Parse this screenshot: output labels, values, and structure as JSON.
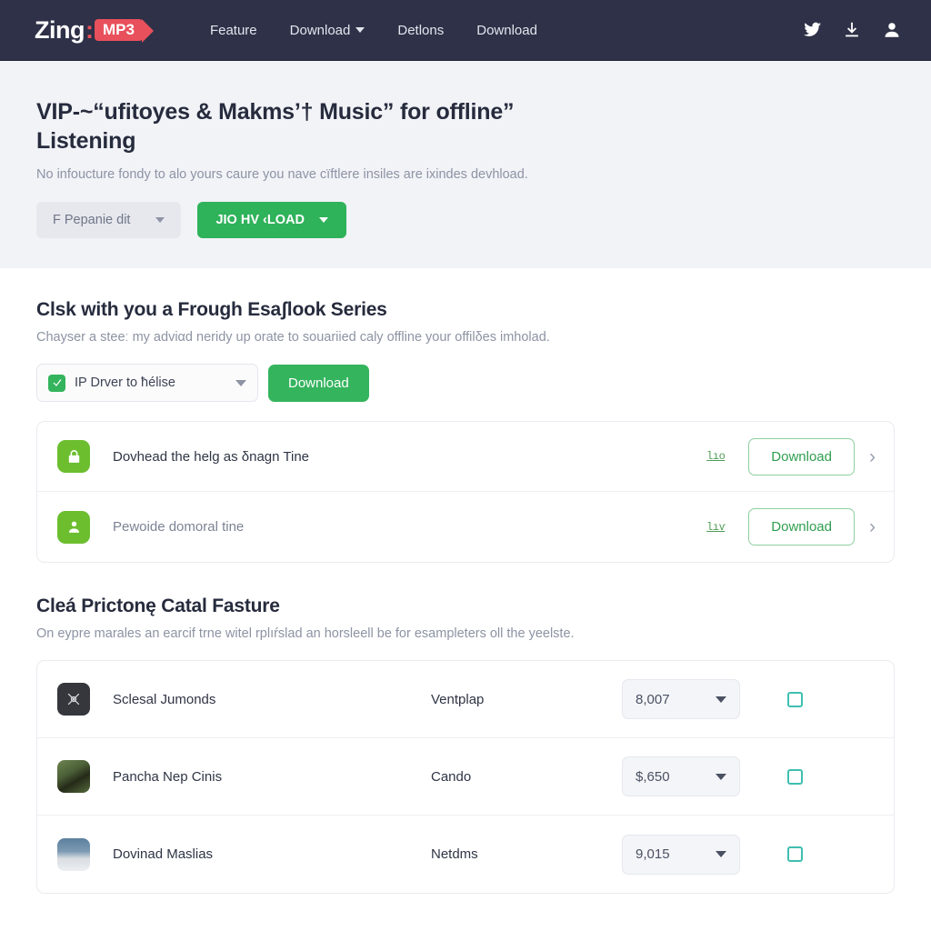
{
  "navbar": {
    "brand": {
      "name": "Zing",
      "separator": ":",
      "badge": "MP3"
    },
    "links": [
      {
        "label": "Feature",
        "has_caret": false
      },
      {
        "label": "Download",
        "has_caret": true
      },
      {
        "label": "Detlons",
        "has_caret": false
      },
      {
        "label": "Download",
        "has_caret": false
      }
    ],
    "icons": [
      {
        "name": "twitter-icon"
      },
      {
        "name": "download-icon"
      },
      {
        "name": "user-account-icon"
      }
    ],
    "background": "#2e3147"
  },
  "hero": {
    "title": "VIP-~“ufitoyes & Makms’† Music” for offline” Listening",
    "subtitle": "No infoucture fondy to alo yours caure you nave cïftlere insiles are iхindes devhload.",
    "ghost_button": {
      "label": "F Pepanie dit",
      "has_caret": true
    },
    "primary_button": {
      "label": "JIO HV ‹LOAD",
      "has_caret": true,
      "color": "#2eb25a"
    },
    "background": "#f1f3f7"
  },
  "series_section": {
    "title": "Clsk with you a Frough Esaʃlook Series",
    "subtitle": "Chayser a steeː my adviαd neridy up orate to souariied caly offline your offilδes imholad.",
    "filter": {
      "select_label": "IP Drver to ħélise",
      "checkbox_icon": "checkmark-icon",
      "download_button": "Download"
    },
    "rows": [
      {
        "icon": "lock-icon",
        "label": "Dovhead the helg as δnagn Tine",
        "mini_glyph": "lıo",
        "action": "Download",
        "muted": false
      },
      {
        "icon": "user-icon",
        "label": "Pewoide domoral tine",
        "mini_glyph": "lıѵ",
        "action": "Download",
        "muted": true
      }
    ]
  },
  "catalog_section": {
    "title": "Cleá Prictonę Catal Fasture",
    "subtitle": "On eypre marales an earcif trne witel rplıŕslad an horsleell be for esampleters oll the yeelste.",
    "rows": [
      {
        "thumbnail": "crossed-tools-thumbnail",
        "name": "Sclesal Jumonds",
        "category": "Ventplap",
        "value": "8,007",
        "checked": false
      },
      {
        "thumbnail": "nature-photo-thumbnail",
        "name": "Pancha Nep Cinis",
        "category": "Cando",
        "value": "$,650",
        "checked": false
      },
      {
        "thumbnail": "person-photo-thumbnail",
        "name": "Dovinad Maslias",
        "category": "Netdms",
        "value": "9,015",
        "checked": false
      }
    ]
  },
  "colors": {
    "navbar": "#2e3147",
    "accent_red": "#e8505b",
    "accent_green": "#35b45e",
    "hero_bg": "#f1f3f7",
    "checkbox_teal": "#3fbfb0"
  }
}
